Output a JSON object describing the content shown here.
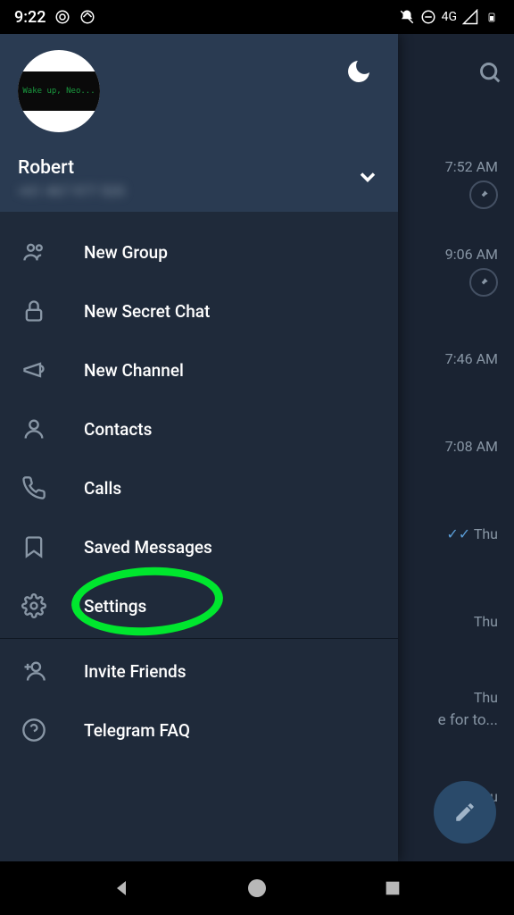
{
  "statusBar": {
    "time": "9:22",
    "network": "4G"
  },
  "user": {
    "name": "Robert",
    "phone": "+61 467 977 520",
    "avatarText": "Wake up, Neo..."
  },
  "menu": {
    "newGroup": "New Group",
    "newSecretChat": "New Secret Chat",
    "newChannel": "New Channel",
    "contacts": "Contacts",
    "calls": "Calls",
    "savedMessages": "Saved Messages",
    "settings": "Settings",
    "inviteFriends": "Invite Friends",
    "telegramFaq": "Telegram FAQ"
  },
  "chats": {
    "items": [
      {
        "time": "7:52 AM",
        "pinned": true
      },
      {
        "time": "9:06 AM",
        "pinned": true,
        "preview": "/"
      },
      {
        "time": "7:46 AM"
      },
      {
        "time": "7:08 AM"
      },
      {
        "time": "Thu",
        "read": true
      },
      {
        "time": "Thu"
      },
      {
        "time": "Thu",
        "preview": "e for to..."
      },
      {
        "time": "Thu",
        "read": true
      }
    ]
  }
}
